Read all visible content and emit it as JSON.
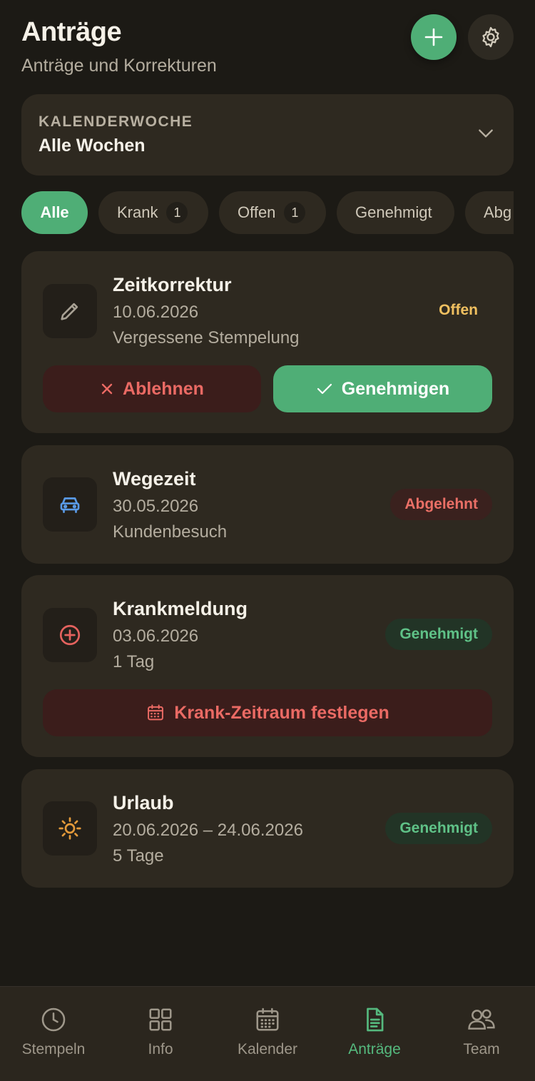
{
  "header": {
    "title": "Anträge",
    "subtitle": "Anträge und Korrekturen",
    "add_icon": "plus-icon",
    "settings_icon": "gear-icon"
  },
  "week_selector": {
    "label": "KALENDERWOCHE",
    "value": "Alle Wochen"
  },
  "filters": [
    {
      "label": "Alle",
      "active": true
    },
    {
      "label": "Krank",
      "count": "1"
    },
    {
      "label": "Offen",
      "count": "1"
    },
    {
      "label": "Genehmigt"
    },
    {
      "label": "Abg"
    }
  ],
  "requests": [
    {
      "title": "Zeitkorrektur",
      "date": "10.06.2026",
      "note": "Vergessene Stempelung",
      "status": "Offen",
      "icon": "pencil-icon",
      "reject_label": "Ablehnen",
      "approve_label": "Genehmigen"
    },
    {
      "title": "Wegezeit",
      "date": "30.05.2026",
      "note": "Kundenbesuch",
      "status": "Abgelehnt",
      "icon": "car-icon"
    },
    {
      "title": "Krankmeldung",
      "date": "03.06.2026",
      "note": "1 Tag",
      "status": "Genehmigt",
      "icon": "plus-circle-icon",
      "action_label": "Krank-Zeitraum festlegen"
    },
    {
      "title": "Urlaub",
      "date": "20.06.2026 – 24.06.2026",
      "note": "5 Tage",
      "status": "Genehmigt",
      "icon": "sun-icon"
    }
  ],
  "nav": [
    {
      "label": "Stempeln",
      "icon": "clock-icon"
    },
    {
      "label": "Info",
      "icon": "grid-icon"
    },
    {
      "label": "Kalender",
      "icon": "calendar-icon"
    },
    {
      "label": "Anträge",
      "icon": "document-icon",
      "active": true
    },
    {
      "label": "Team",
      "icon": "users-icon"
    }
  ],
  "colors": {
    "background": "#1c1a15",
    "card": "#2e2920",
    "accent": "#4fae76",
    "danger": "#ea6a64",
    "warning": "#f0c060"
  }
}
